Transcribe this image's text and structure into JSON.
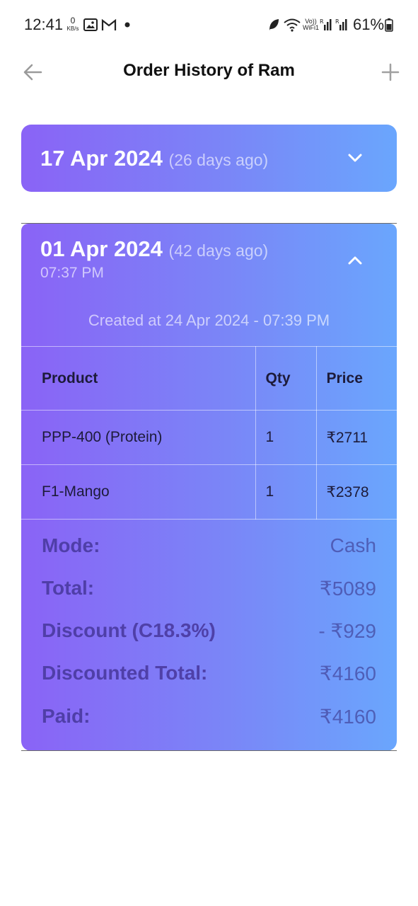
{
  "status_bar": {
    "time": "12:41",
    "kbs_value": "0",
    "kbs_unit": "KB/s",
    "battery": "61%",
    "icons": [
      "gallery-icon",
      "gmail-icon",
      "dot-icon",
      "leaf-icon",
      "wifi-icon",
      "vowifi-icon",
      "signal-icon",
      "signal-icon",
      "battery-icon"
    ]
  },
  "header": {
    "title": "Order History of Ram",
    "back_icon": "arrow-left-icon",
    "add_icon": "plus-icon"
  },
  "orders": [
    {
      "date": "17 Apr 2024",
      "ago": "(26 days ago)",
      "expanded": false
    },
    {
      "date": "01 Apr 2024",
      "ago": "(42 days ago)",
      "time": "07:37 PM",
      "expanded": true,
      "created": "Created at 24 Apr 2024 - 07:39 PM",
      "columns": [
        "Product",
        "Qty",
        "Price"
      ],
      "rows": [
        {
          "product": "PPP-400 (Protein)",
          "qty": "1",
          "price": "₹2711"
        },
        {
          "product": "F1-Mango",
          "qty": "1",
          "price": "₹2378"
        }
      ],
      "summary": {
        "mode_label": "Mode:",
        "mode_value": "Cash",
        "total_label": "Total:",
        "total_value": "₹5089",
        "discount_label": "Discount (C18.3%)",
        "discount_value": "- ₹929",
        "discounted_label": "Discounted Total:",
        "discounted_value": "₹4160",
        "paid_label": "Paid:",
        "paid_value": "₹4160"
      }
    }
  ]
}
